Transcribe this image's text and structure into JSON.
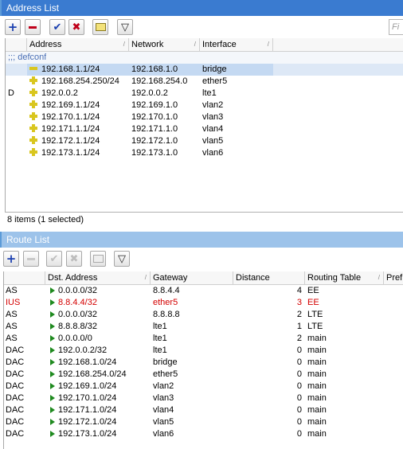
{
  "address_list": {
    "title": "Address List",
    "find_placeholder": "Fi",
    "columns": {
      "address": "Address",
      "network": "Network",
      "interface": "Interface"
    },
    "group_label": ";;; defconf",
    "rows": [
      {
        "flag": "",
        "address": "192.168.1.1/24",
        "network": "192.168.1.0",
        "interface": "bridge",
        "icon": "minus-icon"
      },
      {
        "flag": "",
        "address": "192.168.254.250/24",
        "network": "192.168.254.0",
        "interface": "ether5",
        "icon": "plus-icon"
      },
      {
        "flag": "D",
        "address": "192.0.0.2",
        "network": "192.0.0.2",
        "interface": "lte1",
        "icon": "plus-icon"
      },
      {
        "flag": "",
        "address": "192.169.1.1/24",
        "network": "192.169.1.0",
        "interface": "vlan2",
        "icon": "plus-icon"
      },
      {
        "flag": "",
        "address": "192.170.1.1/24",
        "network": "192.170.1.0",
        "interface": "vlan3",
        "icon": "plus-icon"
      },
      {
        "flag": "",
        "address": "192.171.1.1/24",
        "network": "192.171.1.0",
        "interface": "vlan4",
        "icon": "plus-icon"
      },
      {
        "flag": "",
        "address": "192.172.1.1/24",
        "network": "192.172.1.0",
        "interface": "vlan5",
        "icon": "plus-icon"
      },
      {
        "flag": "",
        "address": "192.173.1.1/24",
        "network": "192.173.1.0",
        "interface": "vlan6",
        "icon": "plus-icon"
      }
    ],
    "status": "8 items (1 selected)",
    "colors": {
      "title_bg": "#3a7bd0",
      "selection": "#c4d9f2",
      "icon": "#d9c61f"
    }
  },
  "route_list": {
    "title": "Route List",
    "columns": {
      "dst": "Dst. Address",
      "gateway": "Gateway",
      "distance": "Distance",
      "routing_table": "Routing Table",
      "pref": "Pref"
    },
    "rows": [
      {
        "flag": "AS",
        "dst": "0.0.0.0/32",
        "gateway": "8.8.4.4",
        "distance": "4",
        "table": "EE",
        "red": false
      },
      {
        "flag": "IUS",
        "dst": "8.8.4.4/32",
        "gateway": "ether5",
        "distance": "3",
        "table": "EE",
        "red": true
      },
      {
        "flag": "AS",
        "dst": "0.0.0.0/32",
        "gateway": "8.8.8.8",
        "distance": "2",
        "table": "LTE",
        "red": false
      },
      {
        "flag": "AS",
        "dst": "8.8.8.8/32",
        "gateway": "lte1",
        "distance": "1",
        "table": "LTE",
        "red": false
      },
      {
        "flag": "AS",
        "dst": "0.0.0.0/0",
        "gateway": "lte1",
        "distance": "2",
        "table": "main",
        "red": false
      },
      {
        "flag": "DAC",
        "dst": "192.0.0.2/32",
        "gateway": "lte1",
        "distance": "0",
        "table": "main",
        "red": false
      },
      {
        "flag": "DAC",
        "dst": "192.168.1.0/24",
        "gateway": "bridge",
        "distance": "0",
        "table": "main",
        "red": false
      },
      {
        "flag": "DAC",
        "dst": "192.168.254.0/24",
        "gateway": "ether5",
        "distance": "0",
        "table": "main",
        "red": false
      },
      {
        "flag": "DAC",
        "dst": "192.169.1.0/24",
        "gateway": "vlan2",
        "distance": "0",
        "table": "main",
        "red": false
      },
      {
        "flag": "DAC",
        "dst": "192.170.1.0/24",
        "gateway": "vlan3",
        "distance": "0",
        "table": "main",
        "red": false
      },
      {
        "flag": "DAC",
        "dst": "192.171.1.0/24",
        "gateway": "vlan4",
        "distance": "0",
        "table": "main",
        "red": false
      },
      {
        "flag": "DAC",
        "dst": "192.172.1.0/24",
        "gateway": "vlan5",
        "distance": "0",
        "table": "main",
        "red": false
      },
      {
        "flag": "DAC",
        "dst": "192.173.1.0/24",
        "gateway": "vlan6",
        "distance": "0",
        "table": "main",
        "red": false
      }
    ],
    "colors": {
      "title_bg": "#9dc3ea",
      "inactive_route": "#d40000",
      "arrow": "#1f8a1f"
    }
  }
}
